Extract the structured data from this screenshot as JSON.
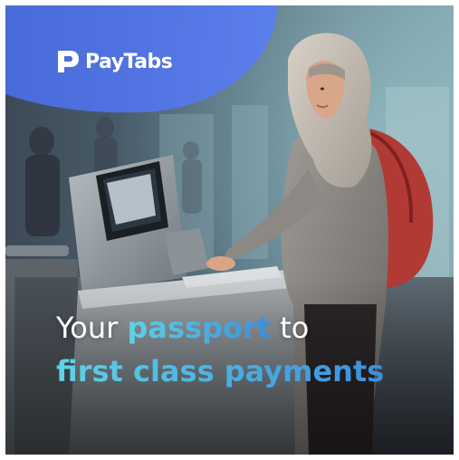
{
  "brand": {
    "name": "PayTabs",
    "logo_icon": "paytabs-p-icon"
  },
  "headline": {
    "line1_plain_before": "Your ",
    "line1_accent": "passport",
    "line1_plain_after": " to",
    "line2_accent": "first class payments"
  },
  "colors": {
    "accent_gradient_start": "#5ed3e6",
    "accent_gradient_end": "#3a8fdf",
    "banner_blue": "#4a6ce0",
    "text_white": "#ffffff"
  }
}
